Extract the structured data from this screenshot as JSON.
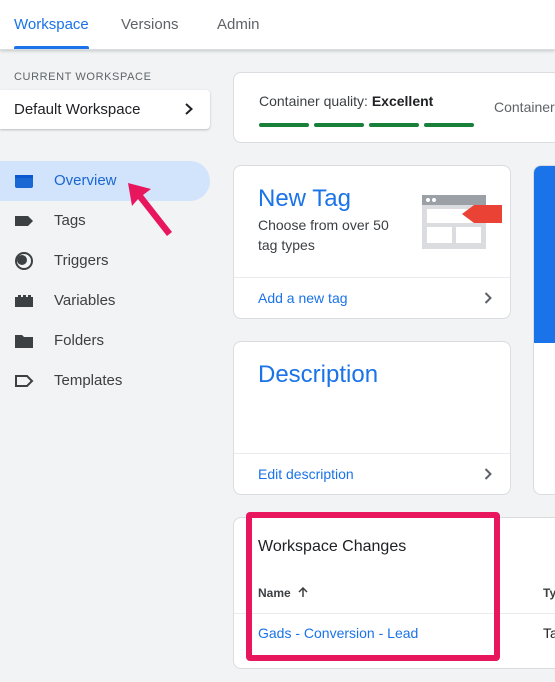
{
  "tabs": {
    "workspace": "Workspace",
    "versions": "Versions",
    "admin": "Admin"
  },
  "sidebar": {
    "current_workspace_label": "CURRENT WORKSPACE",
    "workspace_name": "Default Workspace",
    "items": [
      {
        "label": "Overview",
        "icon": "overview-icon",
        "active": true
      },
      {
        "label": "Tags",
        "icon": "tag-icon"
      },
      {
        "label": "Triggers",
        "icon": "trigger-icon"
      },
      {
        "label": "Variables",
        "icon": "variables-icon"
      },
      {
        "label": "Folders",
        "icon": "folder-icon"
      },
      {
        "label": "Templates",
        "icon": "template-icon"
      }
    ]
  },
  "quality": {
    "label": "Container quality:",
    "value": "Excellent",
    "right_text": "Container"
  },
  "new_tag": {
    "title": "New Tag",
    "description": "Choose from over 50 tag types",
    "link": "Add a new tag"
  },
  "description_card": {
    "title": "Description",
    "link": "Edit description"
  },
  "workspace_changes": {
    "title": "Workspace Changes",
    "col_name": "Name",
    "col_type": "Ty",
    "rows": [
      {
        "name": "Gads - Conversion - Lead",
        "type": "Ta"
      }
    ]
  },
  "colors": {
    "accent": "#1a73e8",
    "active_nav_bg": "#d2e3fc",
    "quality_bar": "#188038",
    "annotation": "#e8175d",
    "tag_icon_red": "#ea4335"
  }
}
